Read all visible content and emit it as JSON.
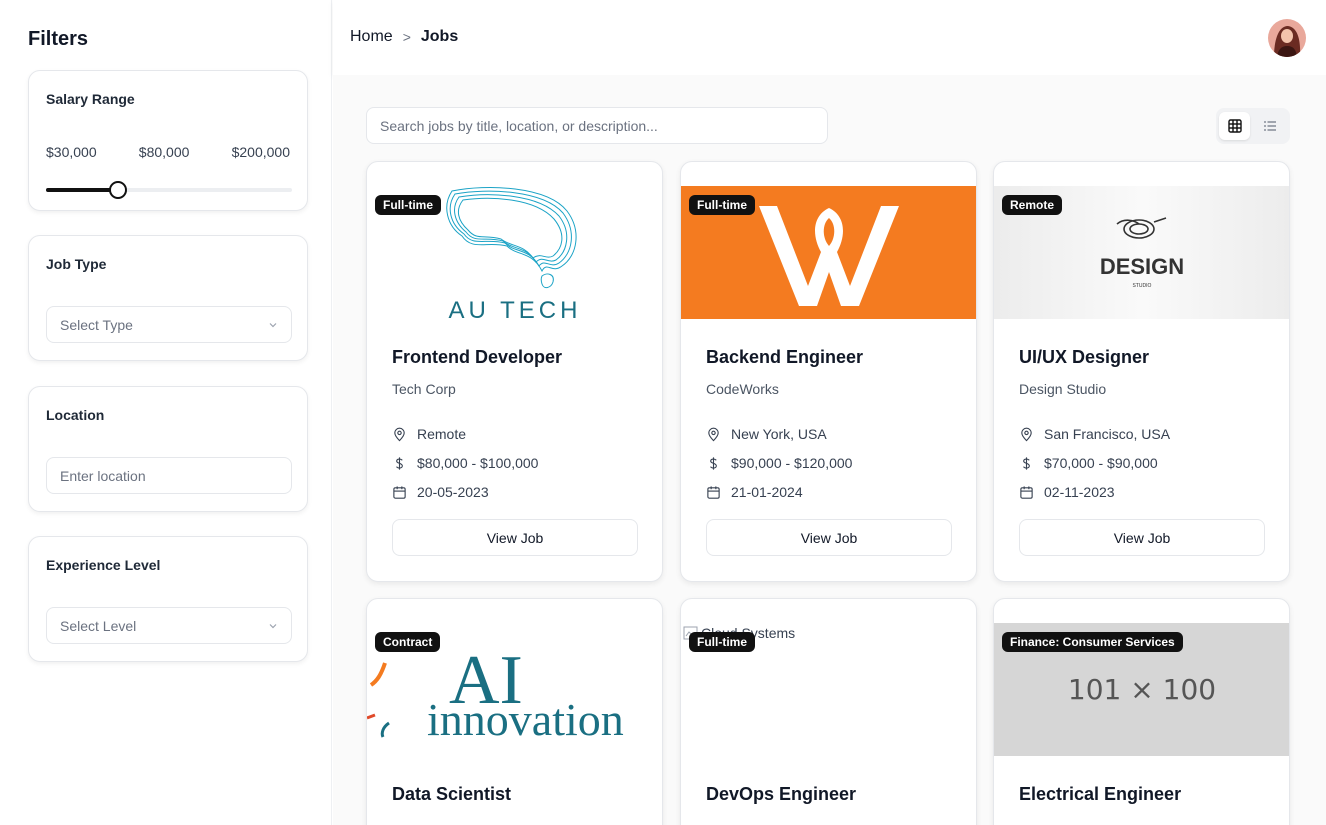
{
  "sidebar": {
    "title": "Filters",
    "salary": {
      "title": "Salary Range",
      "min_label": "$30,000",
      "current_label": "$80,000",
      "max_label": "$200,000",
      "min": 30000,
      "max": 200000,
      "value": 80000
    },
    "job_type": {
      "title": "Job Type",
      "placeholder": "Select Type"
    },
    "location": {
      "title": "Location",
      "placeholder": "Enter location"
    },
    "experience": {
      "title": "Experience Level",
      "placeholder": "Select Level"
    }
  },
  "header": {
    "breadcrumb": {
      "home": "Home",
      "separator": ">",
      "current": "Jobs"
    },
    "avatar_icon": "user-avatar"
  },
  "main": {
    "search_placeholder": "Search jobs by title, location, or description...",
    "view_modes": [
      "grid",
      "list"
    ],
    "active_view": "grid",
    "jobs": [
      {
        "badge": "Full-time",
        "title": "Frontend Developer",
        "company": "Tech Corp",
        "location": "Remote",
        "salary": "$80,000 - $100,000",
        "date": "20-05-2023",
        "button": "View Job",
        "logo_text": "AU TECH"
      },
      {
        "badge": "Full-time",
        "title": "Backend Engineer",
        "company": "CodeWorks",
        "location": "New York, USA",
        "salary": "$90,000 - $120,000",
        "date": "21-01-2024",
        "button": "View Job"
      },
      {
        "badge": "Remote",
        "title": "UI/UX Designer",
        "company": "Design Studio",
        "location": "San Francisco, USA",
        "salary": "$70,000 - $90,000",
        "date": "02-11-2023",
        "button": "View Job",
        "logo_text": "DESIGN",
        "logo_subtext": "STUDIO"
      },
      {
        "badge": "Contract",
        "title": "Data Scientist",
        "logo_text": "AI",
        "logo_subtext": "innovation"
      },
      {
        "badge": "Full-time",
        "title": "DevOps Engineer",
        "image_alt": "Cloud Systems"
      },
      {
        "badge": "Finance: Consumer Services",
        "title": "Electrical Engineer",
        "placeholder_text": "101 × 100"
      }
    ]
  },
  "colors": {
    "accent": "#111111",
    "orange": "#f47b20",
    "teal": "#1a6f82"
  }
}
